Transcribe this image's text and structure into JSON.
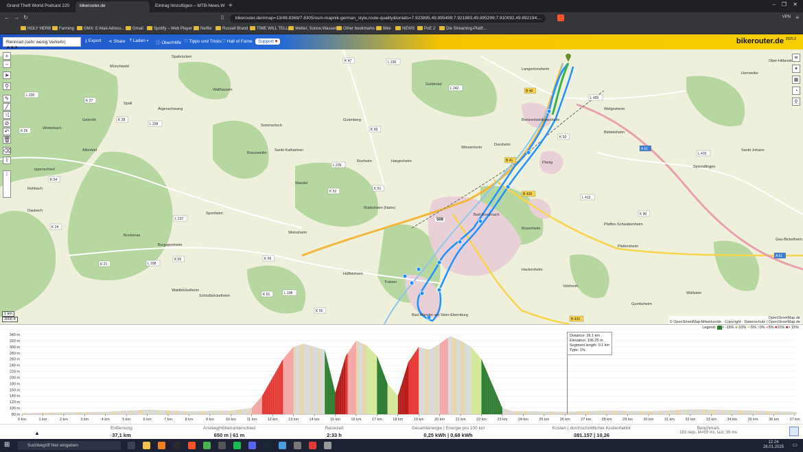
{
  "browser": {
    "tabs": [
      {
        "label": "Grand Theft World Podcast 220",
        "active": false
      },
      {
        "label": "bikerouter.de",
        "active": true
      },
      {
        "label": "Eintrag hinzufügen – MTB-News.W",
        "active": false
      }
    ],
    "url": "bikerouter.de/#map=13/49.8368/7.8305/osm-mapnik-german_style,route-quality&lonlats=7.923895,49.895499;7.921883,49.895299;7.910092,49.892194;...",
    "vpn_label": "VPN",
    "bookmarks": [
      "HOLY HERB",
      "Farming",
      "GMX: E-Mail-Adress...",
      "Gmail",
      "Spotify – Web Player",
      "Netflix",
      "Russell Brand",
      "TIME WILL TELL",
      "Wetter, Sonne,Wasser",
      "Other bookmarks",
      "Bike",
      "NEWS",
      "PoE 2",
      "Die Streaming-Plattf..."
    ]
  },
  "toolbar": {
    "profile": "Rennrad (sehr wenig Verkehr) ★★★",
    "export": "Export",
    "share": "Share",
    "load": "Laden",
    "about": "Über/Hilfe",
    "tips": "Tipps und Tricks",
    "fame": "Hall of Fame",
    "support": "Support",
    "brand": "bikerouter.de",
    "version": "2025.2"
  },
  "map": {
    "places": [
      "Spabrücken",
      "Münchwald",
      "Wallhausen",
      "Spall",
      "Argenschwang",
      "Gebroth",
      "Winterbach",
      "Sommerloch",
      "Guldental",
      "Gutenberg",
      "Langenlonsheim",
      "Bretzenheim",
      "Welgesheim",
      "Ippesheim",
      "Winzenheim",
      "Biebelsheim",
      "Sankt Katharinen",
      "Braunweiler",
      "Hargesheim",
      "Roxheim",
      "Mandel",
      "Rüdesheim (Nahe)",
      "Bad Kreuznach",
      "Planig",
      "Bosenheim",
      "Pfaffen-Schwabenheim",
      "Sprendlingen",
      "Weinsheim",
      "Bockenau",
      "Burgsponheim",
      "Hüffelsheim",
      "Traisen",
      "Hackenheim",
      "Volxheim",
      "Pleitersheim",
      "Bad Münster am Stein-Ebernburg",
      "Gumbsheim",
      "Wöllstein",
      "Sponheim",
      "Allenfeld",
      "Ippenschied",
      "Rehbach",
      "Daubach",
      "Schloßböckelheim",
      "Waldböckelheim",
      "Gau-Bickelheim",
      "Ober-Hilbersheim",
      "Sankt Johann",
      "Horrweiler",
      "Dorsheim"
    ],
    "roads": [
      "B 48",
      "B 41",
      "B 428",
      "B 420",
      "A 61",
      "A 61",
      "K 92",
      "L 236",
      "L 239",
      "L 108",
      "L 242",
      "K 50",
      "K 51",
      "K 52",
      "K 27",
      "L 230",
      "K 28",
      "L 238",
      "L 237",
      "L 108",
      "K 26",
      "L 415",
      "L 413",
      "K 90",
      "L 400",
      "K 59",
      "K 61",
      "K 54",
      "K 55",
      "K 21",
      "K 24",
      "L 234",
      "K 56",
      "K 47"
    ],
    "marker_label": "508",
    "scale_metric": "1 km",
    "scale_imperial": "3000 ft",
    "attribution": "© OpenStreetMap-Mitwirkende · Copyright · Datenschutz | OpenStreetMap.de",
    "attribution_top": "OpenStreetMap.de"
  },
  "elevation": {
    "y_ticks": [
      "340 m",
      "320 m",
      "300 m",
      "280 m",
      "260 m",
      "240 m",
      "220 m",
      "200 m",
      "180 m",
      "160 m",
      "140 m",
      "120 m",
      "100 m",
      "80 m"
    ],
    "x_ticks": [
      "0 km",
      "1 km",
      "2 km",
      "3 km",
      "4 km",
      "5 km",
      "6 km",
      "7 km",
      "8 km",
      "9 km",
      "10 km",
      "11 km",
      "12 km",
      "13 km",
      "14 km",
      "15 km",
      "16 km",
      "17 km",
      "18 km",
      "19 km",
      "20 km",
      "21 km",
      "22 km",
      "23 km",
      "24 km",
      "25 km",
      "26 km",
      "27 km",
      "28 km",
      "29 km",
      "30 km",
      "31 km",
      "32 km",
      "33 km",
      "34 km",
      "35 km",
      "36 km",
      "37 km"
    ],
    "legend": [
      "Legend:",
      "< -15%",
      "-10%",
      "-5%",
      "0%",
      "5%",
      "10%",
      "> 15%"
    ],
    "tooltip": {
      "distance": "Distance: 26.1 km",
      "elevation": "Elevation: 106.25 m",
      "segment": "Segment length: 0.1 km",
      "type": "Type: 1%"
    },
    "profile_km": [
      0,
      2,
      4,
      6,
      8,
      10,
      11,
      11.5,
      12,
      12.5,
      13,
      13.5,
      14,
      14.5,
      15,
      15.5,
      16,
      16.5,
      17,
      17.5,
      18,
      18.5,
      19,
      19.5,
      20,
      20.5,
      21,
      21.5,
      22,
      22.5,
      23,
      23.5,
      24,
      26,
      28,
      30,
      32,
      34,
      36,
      37.1
    ],
    "profile_m": [
      84,
      86,
      88,
      95,
      90,
      92,
      100,
      140,
      200,
      260,
      300,
      310,
      300,
      290,
      150,
      270,
      320,
      305,
      270,
      180,
      140,
      250,
      300,
      290,
      310,
      335,
      320,
      300,
      260,
      180,
      100,
      90,
      90,
      88,
      92,
      90,
      96,
      94,
      90,
      88
    ]
  },
  "stats": [
    {
      "label": "Entfernung",
      "value": "37,1 km"
    },
    {
      "label": "Anstieg|Höhenunterschied",
      "value": "650 m | 61 m"
    },
    {
      "label": "Reisezeit",
      "value": "2:33 h"
    },
    {
      "label": "Gesamtenergie | Energie pro 100 km",
      "value": "0,25 kWh | 0,68 kWh"
    },
    {
      "label": "Kosten | durchschnittlicher Kostenfaktor",
      "value": "381.157 | 10,26"
    },
    {
      "label": "Benchmark",
      "value": "183 reqs, M=59 ms, last: 39 ms"
    }
  ],
  "taskbar": {
    "search": "Suchbegriff hier eingeben",
    "time": "12:24",
    "date": "28.01.2025"
  }
}
